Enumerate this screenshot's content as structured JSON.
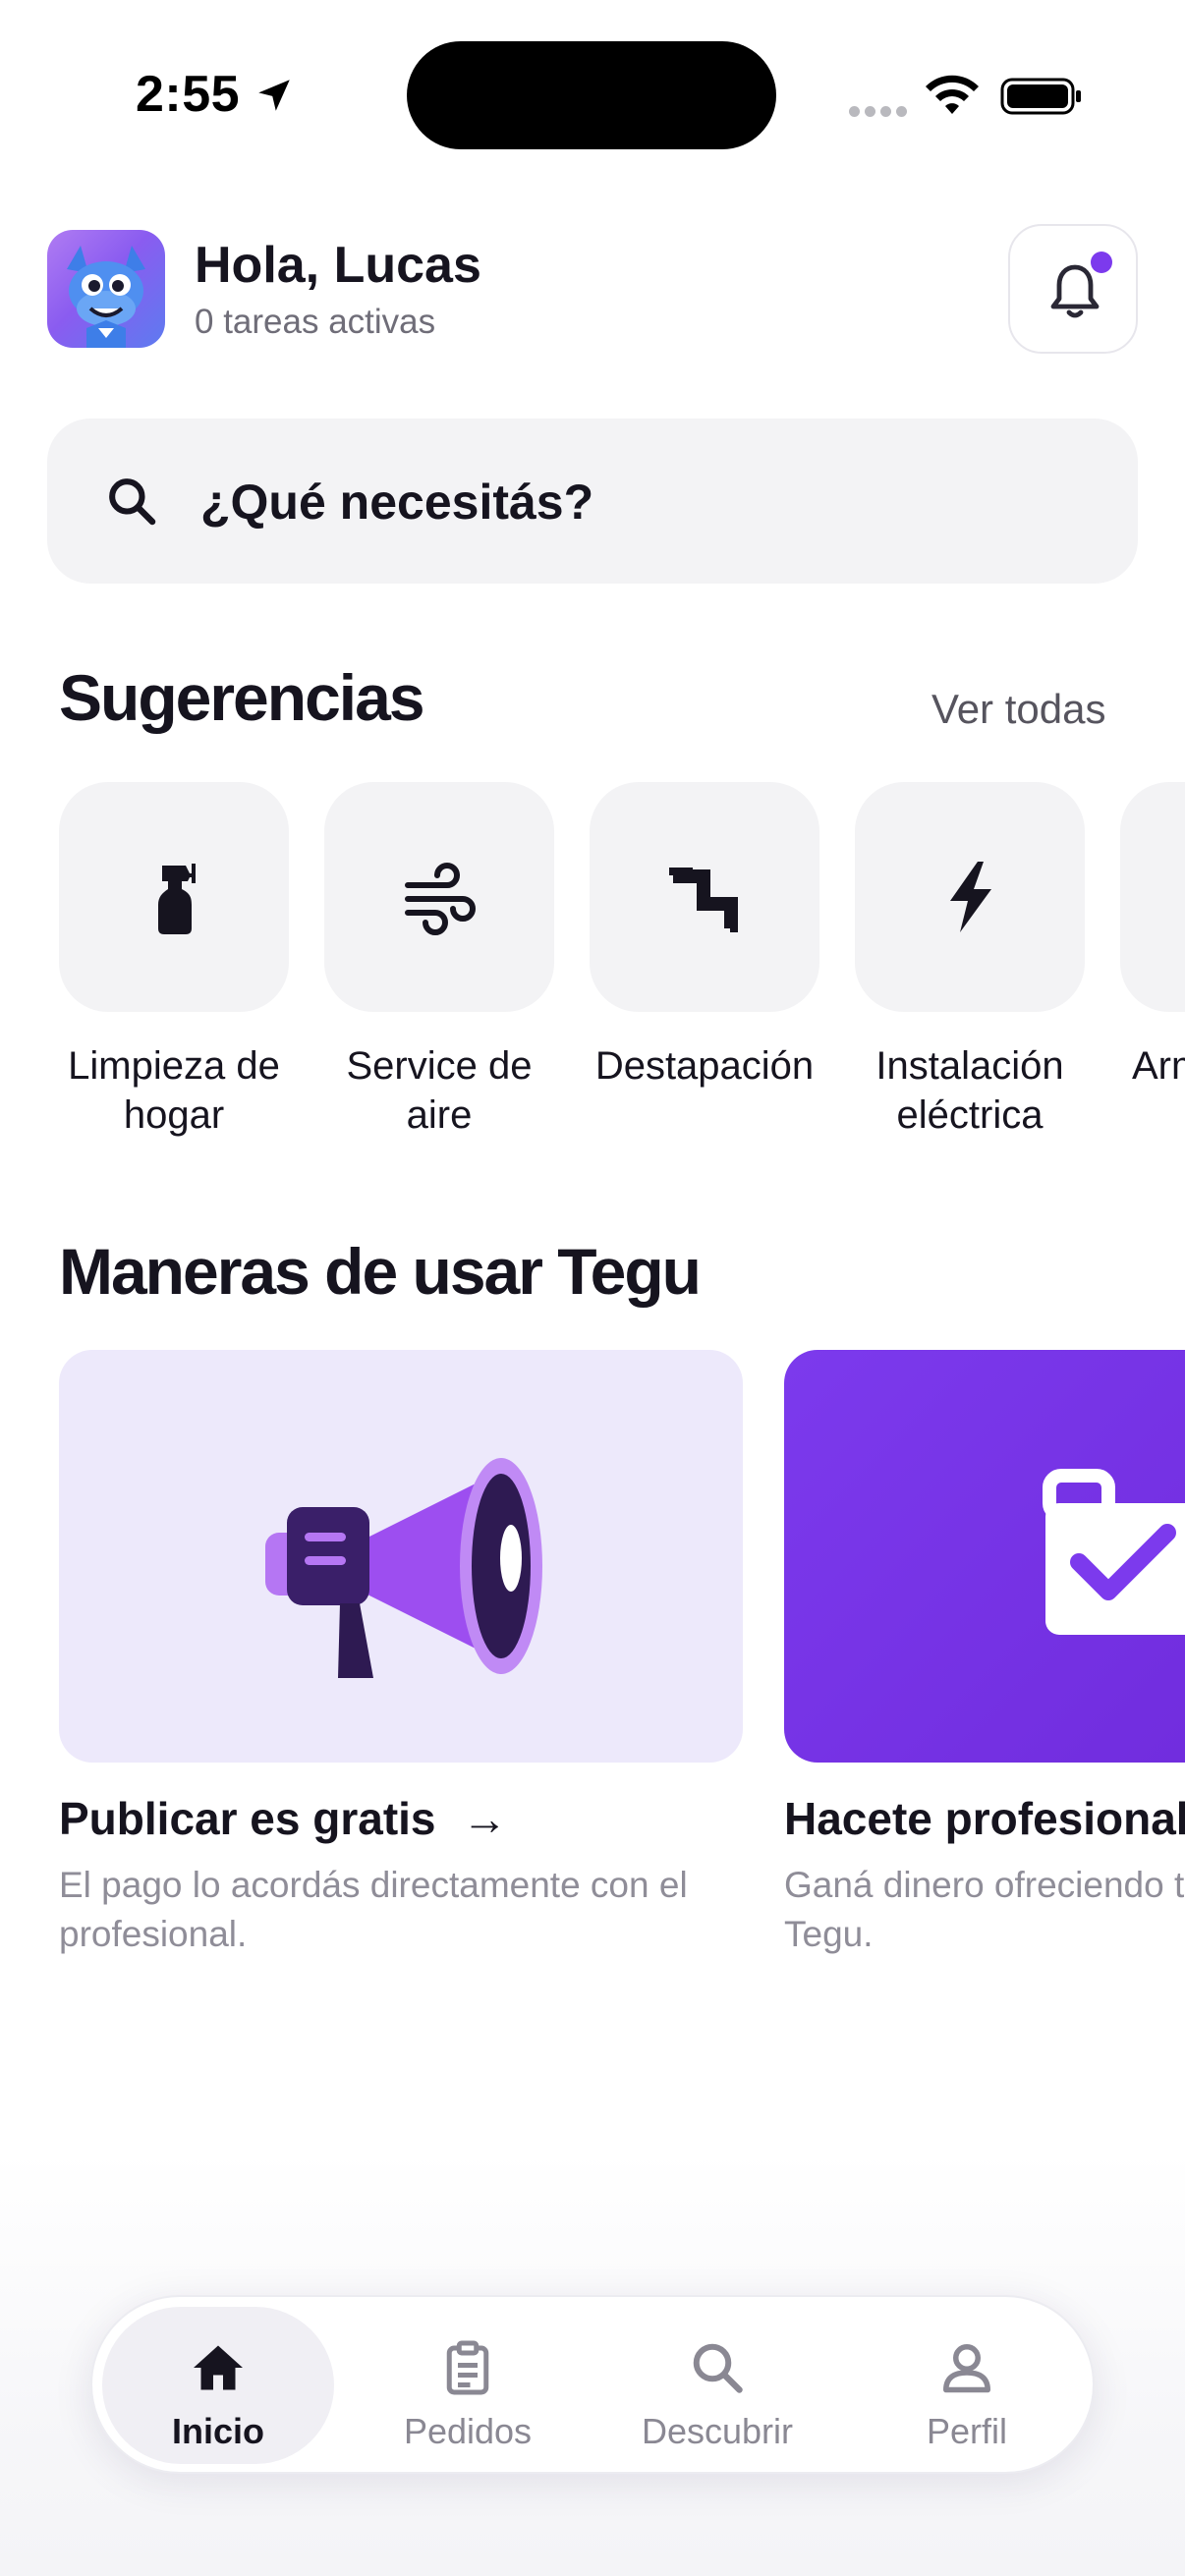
{
  "status_bar": {
    "time": "2:55"
  },
  "header": {
    "greeting": "Hola, Lucas",
    "subtitle": "0 tareas activas",
    "accent_color": "#7c3aed"
  },
  "search": {
    "placeholder": "¿Qué necesitás?"
  },
  "suggestions": {
    "title": "Sugerencias",
    "see_all": "Ver todas",
    "items": [
      {
        "label": "Limpieza de hogar",
        "icon": "spray-bottle-icon"
      },
      {
        "label": "Service de aire",
        "icon": "wind-icon"
      },
      {
        "label": "Destapación",
        "icon": "pipe-icon"
      },
      {
        "label": "Instalación eléctrica",
        "icon": "lightning-icon"
      },
      {
        "label": "Arm",
        "icon": "unknown-icon"
      }
    ]
  },
  "ways": {
    "title": "Maneras de usar Tegu",
    "cards": [
      {
        "title": "Publicar es gratis",
        "arrow": "→",
        "description": "El pago lo acordás directamente con el profesional.",
        "icon": "megaphone-icon"
      },
      {
        "title": "Hacete profesional",
        "description": "Ganá dinero ofreciendo tus servicios en Tegu.",
        "icon": "briefcase-check-icon"
      }
    ]
  },
  "tab_bar": {
    "tabs": [
      {
        "label": "Inicio",
        "icon": "home-icon",
        "active": true
      },
      {
        "label": "Pedidos",
        "icon": "clipboard-icon",
        "active": false
      },
      {
        "label": "Descubrir",
        "icon": "search-icon",
        "active": false
      },
      {
        "label": "Perfil",
        "icon": "person-icon",
        "active": false
      }
    ]
  }
}
